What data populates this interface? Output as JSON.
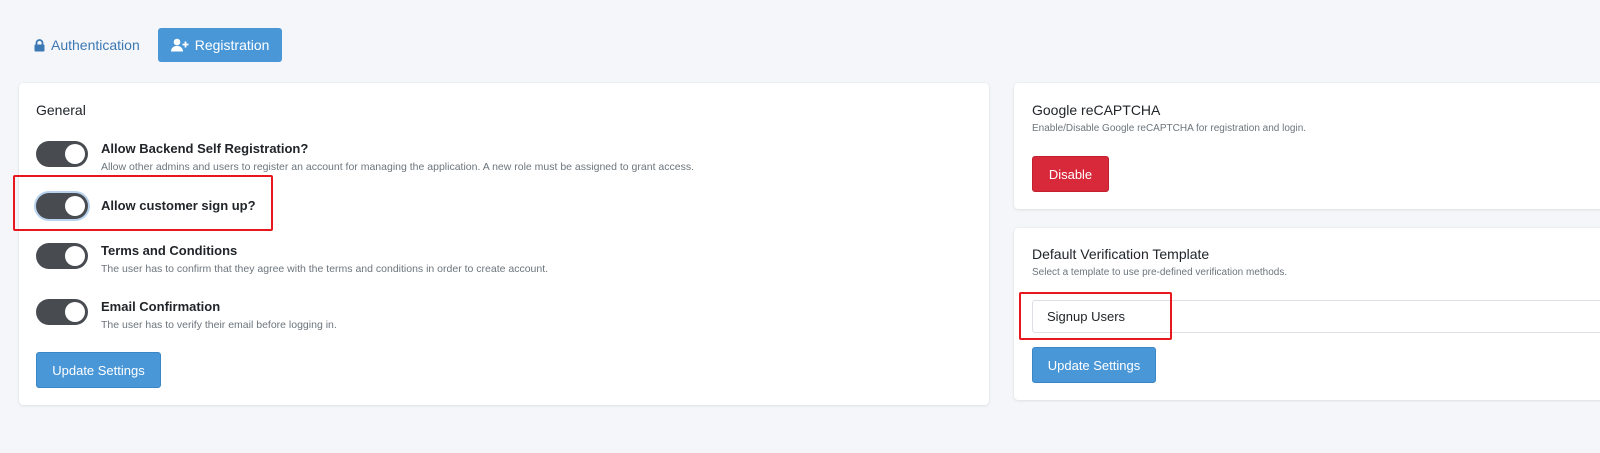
{
  "tabs": [
    {
      "label": "Authentication",
      "icon": "lock-icon",
      "active": false
    },
    {
      "label": "Registration",
      "icon": "user-plus-icon",
      "active": true
    }
  ],
  "general": {
    "title": "General",
    "settings": [
      {
        "label": "Allow Backend Self Registration?",
        "help": "Allow other admins and users to register an account for managing the application. A new role must be assigned to grant access.",
        "enabled": true
      },
      {
        "label": "Allow customer sign up?",
        "help": "",
        "enabled": true
      },
      {
        "label": "Terms and Conditions",
        "help": "The user has to confirm that they agree with the terms and conditions in order to create account.",
        "enabled": true
      },
      {
        "label": "Email Confirmation",
        "help": "The user has to verify their email before logging in.",
        "enabled": true
      }
    ],
    "update_label": "Update Settings"
  },
  "recaptcha": {
    "title": "Google reCAPTCHA",
    "subtitle": "Enable/Disable Google reCAPTCHA for registration and login.",
    "button_label": "Disable"
  },
  "verification": {
    "title": "Default Verification Template",
    "subtitle": "Select a template to use pre-defined verification methods.",
    "selected": "Signup Users",
    "update_label": "Update Settings"
  },
  "colors": {
    "primary": "#4a97d8",
    "danger": "#d7293a",
    "toggle_on": "#484c51",
    "highlight": "#e8171d"
  }
}
